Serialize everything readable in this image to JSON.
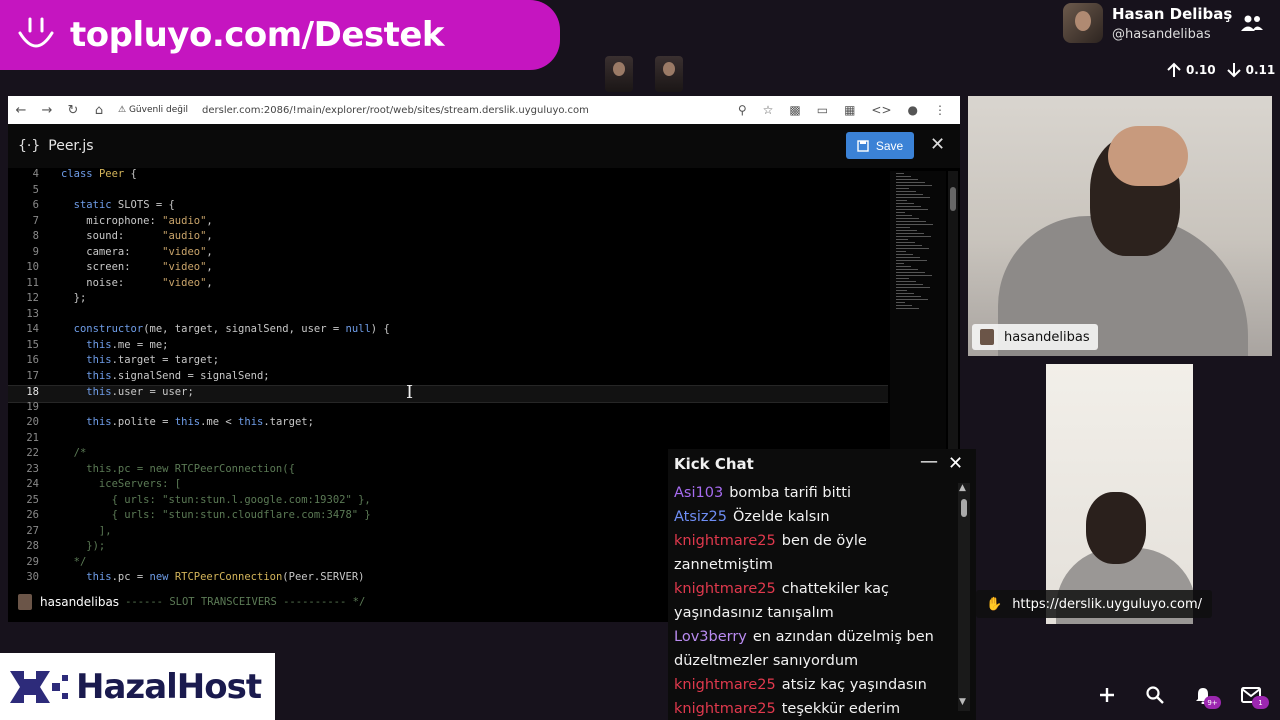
{
  "banner": {
    "text": "topluyo.com/Destek",
    "color": "#c515c0"
  },
  "profile": {
    "name": "Hasan Delibaş",
    "handle": "@hasandelibas"
  },
  "traffic": {
    "up": "0.10",
    "down": "0.11"
  },
  "browser": {
    "security": "Güvenli değil",
    "url": "dersler.com:2086/!main/explorer/root/web/sites/stream.derslik.uyguluyo.com"
  },
  "editor": {
    "file_name": "Peer.js",
    "save_label": "Save",
    "current_line": "18",
    "lines": [
      {
        "n": "4",
        "html": "<span class='kw'>class</span> <span class='cls'>Peer</span> {"
      },
      {
        "n": "5",
        "html": ""
      },
      {
        "n": "6",
        "html": "  <span class='kw'>static</span> SLOTS = {"
      },
      {
        "n": "7",
        "html": "    microphone: <span class='str'>\"audio\"</span>,"
      },
      {
        "n": "8",
        "html": "    sound:      <span class='str'>\"audio\"</span>,"
      },
      {
        "n": "9",
        "html": "    camera:     <span class='str'>\"video\"</span>,"
      },
      {
        "n": "10",
        "html": "    screen:     <span class='str'>\"video\"</span>,"
      },
      {
        "n": "11",
        "html": "    noise:      <span class='str'>\"video\"</span>,"
      },
      {
        "n": "12",
        "html": "  };"
      },
      {
        "n": "13",
        "html": ""
      },
      {
        "n": "14",
        "html": "  <span class='kw'>constructor</span>(me, target, signalSend, user = <span class='kw'>null</span>) {"
      },
      {
        "n": "15",
        "html": "    <span class='kw'>this</span>.me = me;"
      },
      {
        "n": "16",
        "html": "    <span class='kw'>this</span>.target = target;"
      },
      {
        "n": "17",
        "html": "    <span class='kw'>this</span>.signalSend = signalSend;"
      },
      {
        "n": "18",
        "html": "    <span class='kw'>this</span>.user = user;"
      },
      {
        "n": "19",
        "html": ""
      },
      {
        "n": "20",
        "html": "    <span class='kw'>this</span>.polite = <span class='kw'>this</span>.me &lt; <span class='kw'>this</span>.target;"
      },
      {
        "n": "21",
        "html": ""
      },
      {
        "n": "22",
        "html": "  <span class='cm'>/*</span>"
      },
      {
        "n": "23",
        "html": "<span class='cm'>    this.pc = new RTCPeerConnection({</span>"
      },
      {
        "n": "24",
        "html": "<span class='cm'>      iceServers: [</span>"
      },
      {
        "n": "25",
        "html": "<span class='cm'>        { urls: \"stun:stun.l.google.com:19302\" },</span>"
      },
      {
        "n": "26",
        "html": "<span class='cm'>        { urls: \"stun:stun.cloudflare.com:3478\" }</span>"
      },
      {
        "n": "27",
        "html": "<span class='cm'>      ],</span>"
      },
      {
        "n": "28",
        "html": "<span class='cm'>    });</span>"
      },
      {
        "n": "29",
        "html": "<span class='cm'>  */</span>"
      },
      {
        "n": "30",
        "html": "    <span class='kw'>this</span>.pc = <span class='kw'>new</span> <span class='cls'>RTCPeerConnection</span>(Peer.SERVER)"
      }
    ],
    "tail_comment": "------ SLOT TRANSCEIVERS ---------- */"
  },
  "footer_user": "hasandelibas",
  "cam1_label": "hasandelibas",
  "link_chip": "https://derslik.uyguluyo.com/",
  "chat": {
    "title": "Kick Chat",
    "messages": [
      {
        "user": "Asi103",
        "color": "#a66cf0",
        "text": "bomba tarifi bitti"
      },
      {
        "user": "Atsiz25",
        "color": "#6f8ef5",
        "text": "Özelde kalsın"
      },
      {
        "user": "knightmare25",
        "color": "#e0394d",
        "text": "ben de öyle zannetmiştim"
      },
      {
        "user": "knightmare25",
        "color": "#e0394d",
        "text": "chattekiler kaç yaşındasınız tanışalım"
      },
      {
        "user": "Lov3berry",
        "color": "#b98bf0",
        "text": "en azından düzelmiş ben düzeltmezler sanıyordum"
      },
      {
        "user": "knightmare25",
        "color": "#e0394d",
        "text": "atsiz kaç yaşındasın"
      },
      {
        "user": "knightmare25",
        "color": "#e0394d",
        "text": "teşekkür ederim"
      }
    ]
  },
  "sponsor": {
    "text": "HazalHost"
  },
  "notifications": {
    "bell_badge": "9+",
    "mail_badge": "1"
  }
}
